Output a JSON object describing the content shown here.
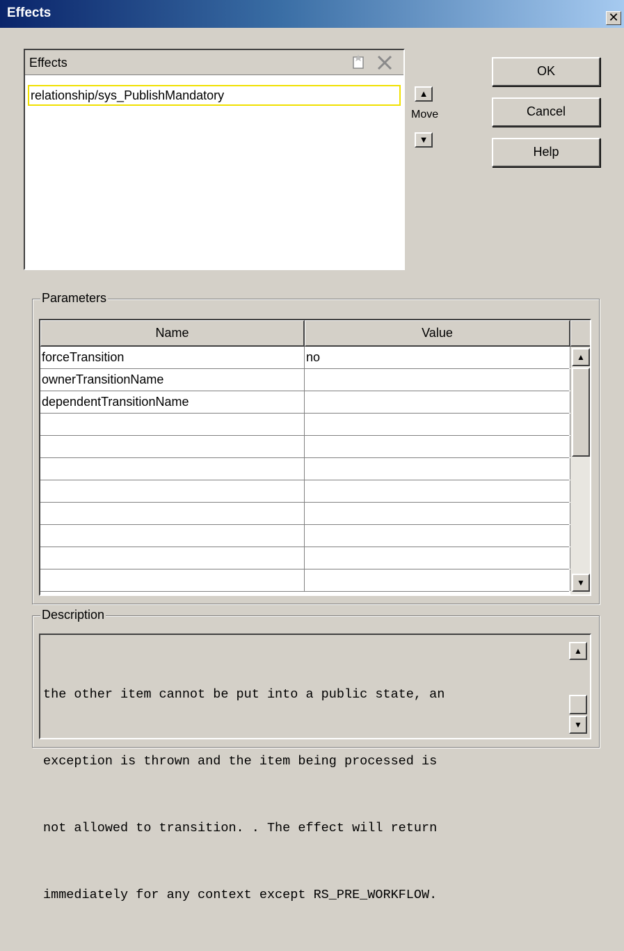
{
  "window": {
    "title": "Effects",
    "close_glyph": "✕"
  },
  "effects": {
    "header_label": "Effects",
    "items": [
      "relationship/sys_PublishMandatory"
    ],
    "move_label": "Move"
  },
  "buttons": {
    "ok": "OK",
    "cancel": "Cancel",
    "help": "Help"
  },
  "parameters": {
    "legend": "Parameters",
    "columns": [
      "Name",
      "Value"
    ],
    "rows": [
      {
        "name": "forceTransition",
        "value": "no"
      },
      {
        "name": "ownerTransitionName",
        "value": ""
      },
      {
        "name": "dependentTransitionName",
        "value": ""
      },
      {
        "name": "",
        "value": ""
      },
      {
        "name": "",
        "value": ""
      },
      {
        "name": "",
        "value": ""
      },
      {
        "name": "",
        "value": ""
      },
      {
        "name": "",
        "value": ""
      },
      {
        "name": "",
        "value": ""
      },
      {
        "name": "",
        "value": ""
      },
      {
        "name": "",
        "value": ""
      }
    ]
  },
  "description": {
    "legend": "Description",
    "lines": [
      "the other item cannot be put into a public state, an",
      "exception is thrown and the item being processed is",
      "not allowed to transition. . The effect will return",
      "immediately for any context except RS_PRE_WORKFLOW."
    ]
  }
}
